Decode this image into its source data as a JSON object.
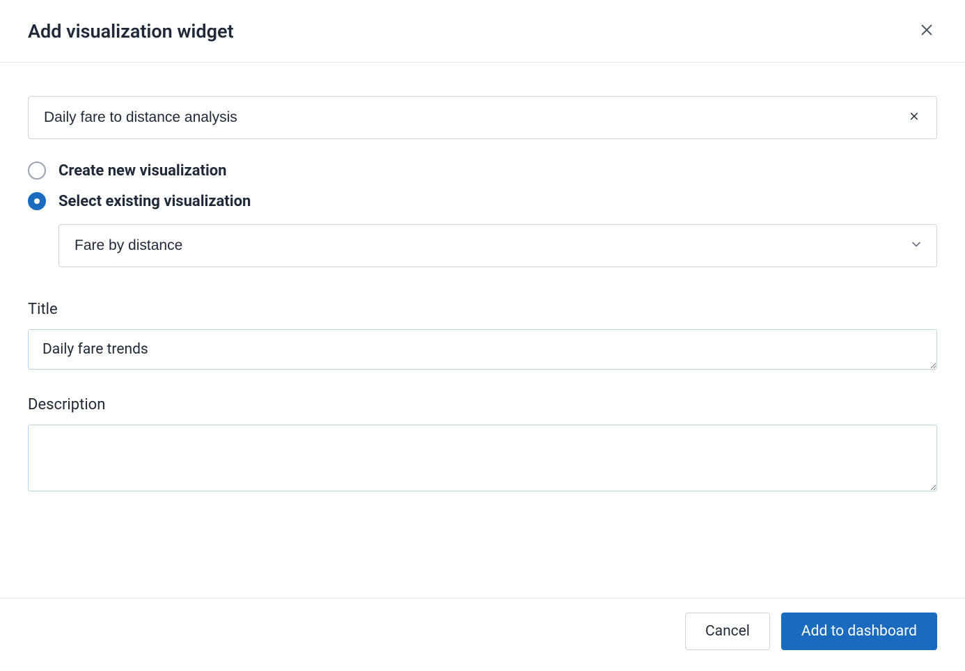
{
  "dialog": {
    "title": "Add visualization widget",
    "search": {
      "value": "Daily fare to distance analysis"
    },
    "radios": {
      "create_label": "Create new visualization",
      "select_label": "Select existing visualization",
      "selected": "select"
    },
    "visualization_select": {
      "value": "Fare by distance"
    },
    "title_field": {
      "label": "Title",
      "value": "Daily fare trends"
    },
    "description_field": {
      "label": "Description",
      "value": ""
    },
    "footer": {
      "cancel_label": "Cancel",
      "submit_label": "Add to dashboard"
    }
  }
}
